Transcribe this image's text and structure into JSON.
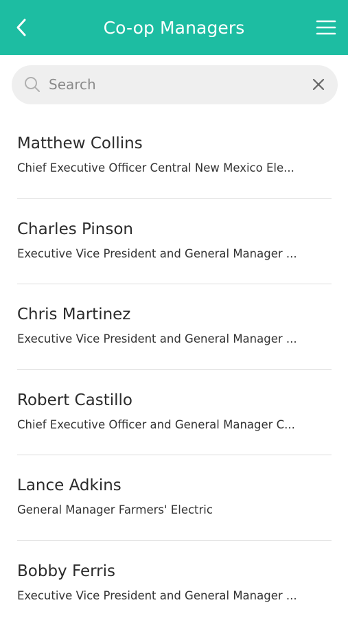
{
  "header": {
    "title": "Co-op Managers",
    "back_icon": "chevron-left-icon",
    "menu_icon": "hamburger-menu-icon",
    "background_color": "#1dbda2"
  },
  "search": {
    "placeholder": "Search",
    "value": "",
    "search_icon": "search-icon",
    "clear_icon": "close-icon"
  },
  "managers": [
    {
      "name": "Matthew Collins",
      "title": "Chief Executive Officer Central New Mexico Ele..."
    },
    {
      "name": "Charles Pinson",
      "title": "Executive Vice President and General Manager ..."
    },
    {
      "name": "Chris Martinez",
      "title": "Executive Vice President and General Manager ..."
    },
    {
      "name": "Robert Castillo",
      "title": "Chief Executive Officer and General Manager C..."
    },
    {
      "name": "Lance Adkins",
      "title": "General Manager Farmers' Electric"
    },
    {
      "name": "Bobby Ferris",
      "title": "Executive Vice President and General Manager ..."
    }
  ]
}
